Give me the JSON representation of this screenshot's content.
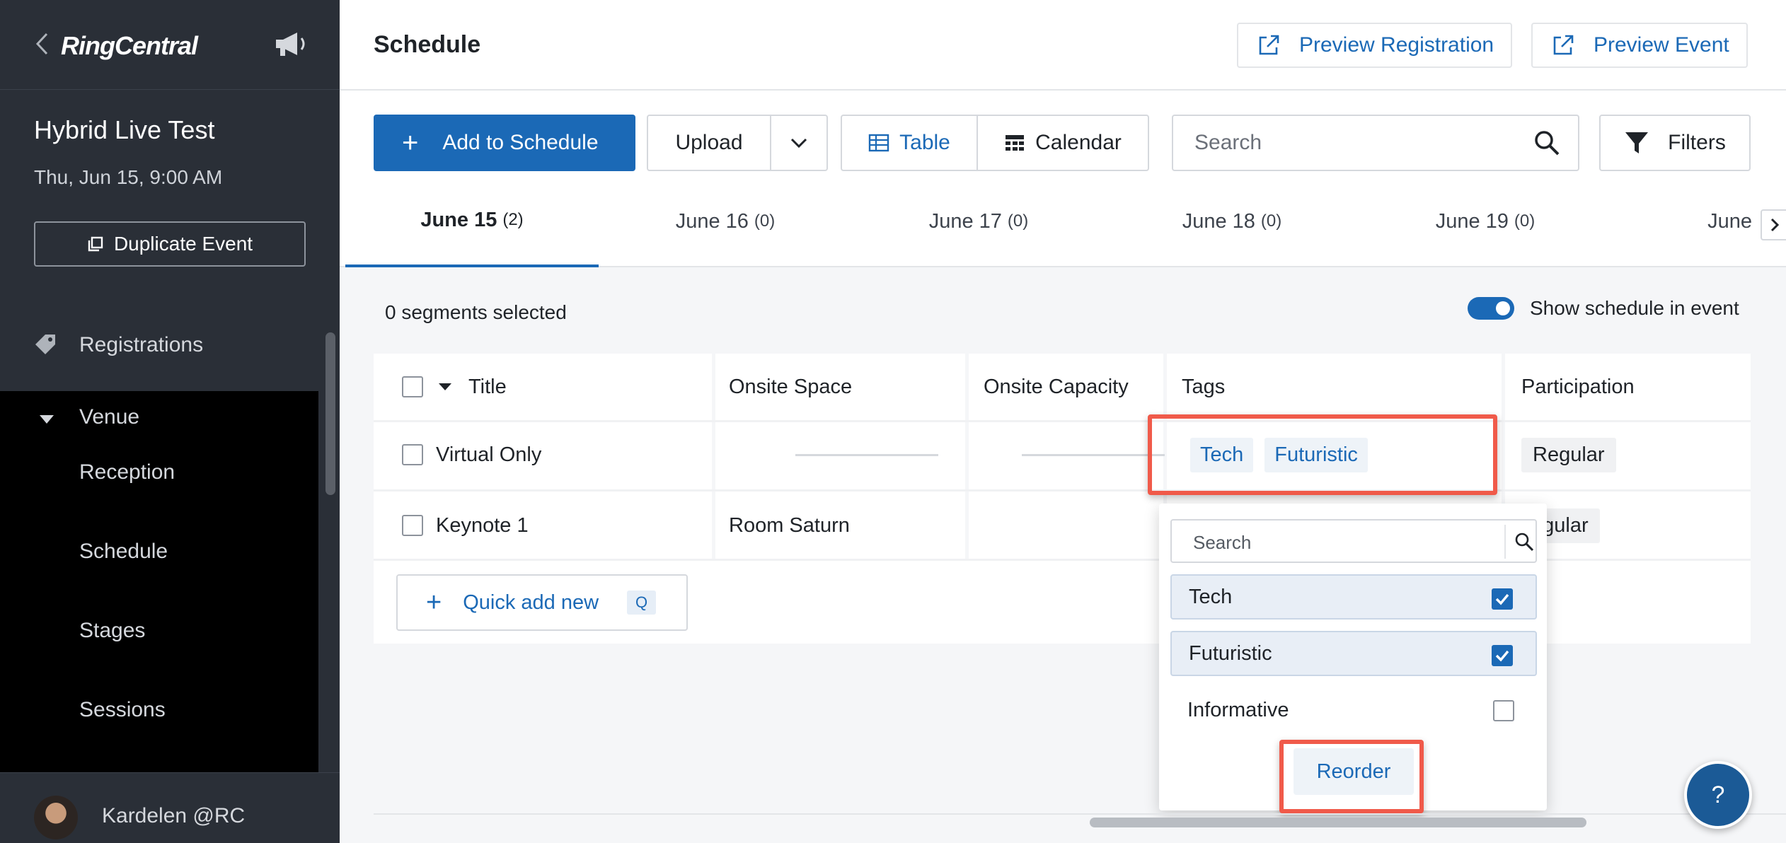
{
  "sidebar": {
    "logo": "RingCentral",
    "event_title": "Hybrid Live Test",
    "event_date": "Thu, Jun 15, 9:00 AM",
    "duplicate_label": "Duplicate Event",
    "nav": {
      "registrations": "Registrations",
      "venue": "Venue",
      "reception": "Reception",
      "schedule": "Schedule",
      "stages": "Stages",
      "sessions": "Sessions"
    },
    "user_name": "Kardelen @RC"
  },
  "header": {
    "title": "Schedule",
    "preview_registration": "Preview Registration",
    "preview_event": "Preview Event"
  },
  "toolbar": {
    "add_label": "Add to Schedule",
    "upload_label": "Upload",
    "view_table": "Table",
    "view_calendar": "Calendar",
    "search_placeholder": "Search",
    "filters_label": "Filters"
  },
  "tabs": [
    {
      "label": "June 15",
      "count": "(2)",
      "active": true
    },
    {
      "label": "June 16",
      "count": "(0)"
    },
    {
      "label": "June 17",
      "count": "(0)"
    },
    {
      "label": "June 18",
      "count": "(0)"
    },
    {
      "label": "June 19",
      "count": "(0)"
    },
    {
      "label": "June",
      "count": ""
    }
  ],
  "selection": {
    "text": "0 segments selected",
    "show_schedule_label": "Show schedule in event",
    "show_schedule_on": true
  },
  "table": {
    "columns": {
      "title": "Title",
      "onsite_space": "Onsite Space",
      "onsite_capacity": "Onsite Capacity",
      "tags": "Tags",
      "participation": "Participation"
    },
    "rows": [
      {
        "title": "Virtual Only",
        "onsite_space": "",
        "tags": [
          "Tech",
          "Futuristic"
        ],
        "participation": "Regular"
      },
      {
        "title": "Keynote 1",
        "onsite_space": "Room Saturn",
        "tags": [],
        "participation": "egular"
      }
    ],
    "quick_add_label": "Quick add new",
    "quick_add_key": "Q"
  },
  "tag_dropdown": {
    "search_placeholder": "Search",
    "options": [
      {
        "label": "Tech",
        "checked": true
      },
      {
        "label": "Futuristic",
        "checked": true
      },
      {
        "label": "Informative",
        "checked": false
      }
    ],
    "reorder_label": "Reorder"
  },
  "help_label": "?",
  "colors": {
    "accent": "#1b69b6",
    "sidebar_bg": "#1a1e24",
    "highlight": "#f05a4a"
  }
}
